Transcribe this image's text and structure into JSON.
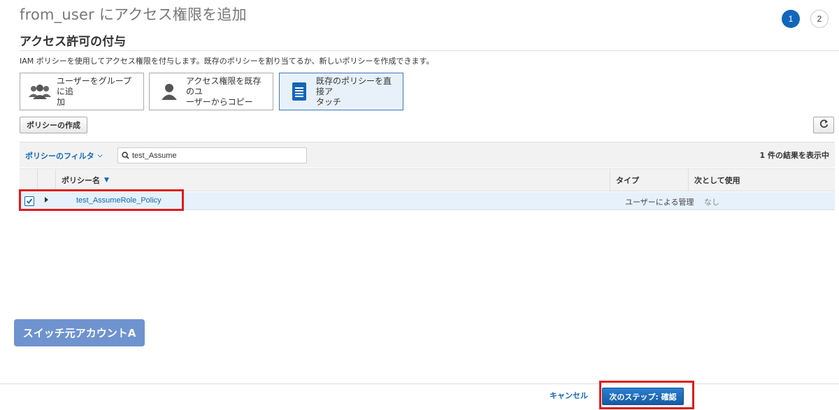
{
  "header": {
    "title": "from_user にアクセス権限を追加",
    "steps": [
      "1",
      "2"
    ]
  },
  "section": {
    "title": "アクセス許可の付与",
    "description": "IAM ポリシーを使用してアクセス権限を付与します。既存のポリシーを割り当てるか、新しいポリシーを作成できます。"
  },
  "options": [
    {
      "label_line1": "ユーザーをグループに追",
      "label_line2": "加",
      "icon": "users-group-icon",
      "selected": false
    },
    {
      "label_line1": "アクセス権限を既存のユ",
      "label_line2": "ーザーからコピー",
      "icon": "user-icon",
      "selected": false
    },
    {
      "label_line1": "既存のポリシーを直接ア",
      "label_line2": "タッチ",
      "icon": "document-icon",
      "selected": true
    }
  ],
  "toolbar": {
    "create_policy_label": "ポリシーの作成",
    "refresh_icon": "refresh-icon"
  },
  "filter": {
    "label": "ポリシーのフィルタ",
    "search_value": "test_Assume",
    "result_count": "1 件の結果を表示中"
  },
  "table": {
    "columns": {
      "name": "ポリシー名",
      "type": "タイプ",
      "used_as": "次として使用"
    },
    "rows": [
      {
        "checked": true,
        "name": "test_AssumeRole_Policy",
        "type": "ユーザーによる管理",
        "used_as": "なし"
      }
    ]
  },
  "badge": {
    "label": "スイッチ元アカウントA"
  },
  "footer": {
    "cancel_label": "キャンセル",
    "next_label": "次のステップ: 確認"
  },
  "colors": {
    "accent": "#1166bb",
    "highlight": "#e01b1b",
    "badge": "#6f93cf",
    "selected_row": "#e6f1fb"
  }
}
